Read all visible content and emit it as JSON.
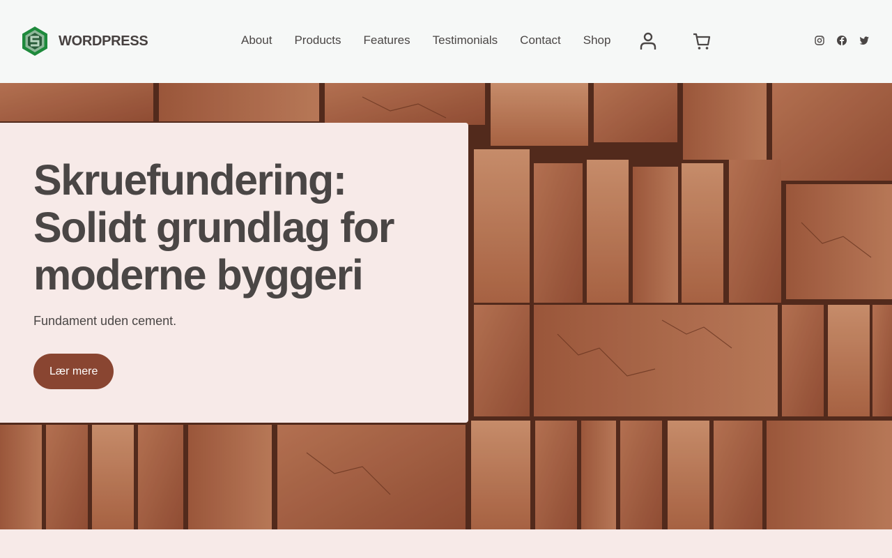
{
  "brand": {
    "name": "WORDPRESS",
    "logo_icon": "hexagon-s-logo-icon"
  },
  "nav": {
    "items": [
      {
        "label": "About"
      },
      {
        "label": "Products"
      },
      {
        "label": "Features"
      },
      {
        "label": "Testimonials"
      },
      {
        "label": "Contact"
      },
      {
        "label": "Shop"
      }
    ]
  },
  "header_icons": {
    "account": "user-icon",
    "cart": "cart-icon"
  },
  "socials": [
    "instagram-icon",
    "facebook-icon",
    "twitter-icon"
  ],
  "hero": {
    "title": "Skruefundering: Solidt grundlag for moderne byggeri",
    "subtitle": "Fundament uden cement.",
    "cta_label": "Lær mere",
    "background": "brick-stack-photo"
  },
  "colors": {
    "header_bg": "#f6f8f7",
    "card_bg": "#f7eae8",
    "text": "#4a4645",
    "button": "#894531",
    "logo_green": "#1e8a3c"
  }
}
